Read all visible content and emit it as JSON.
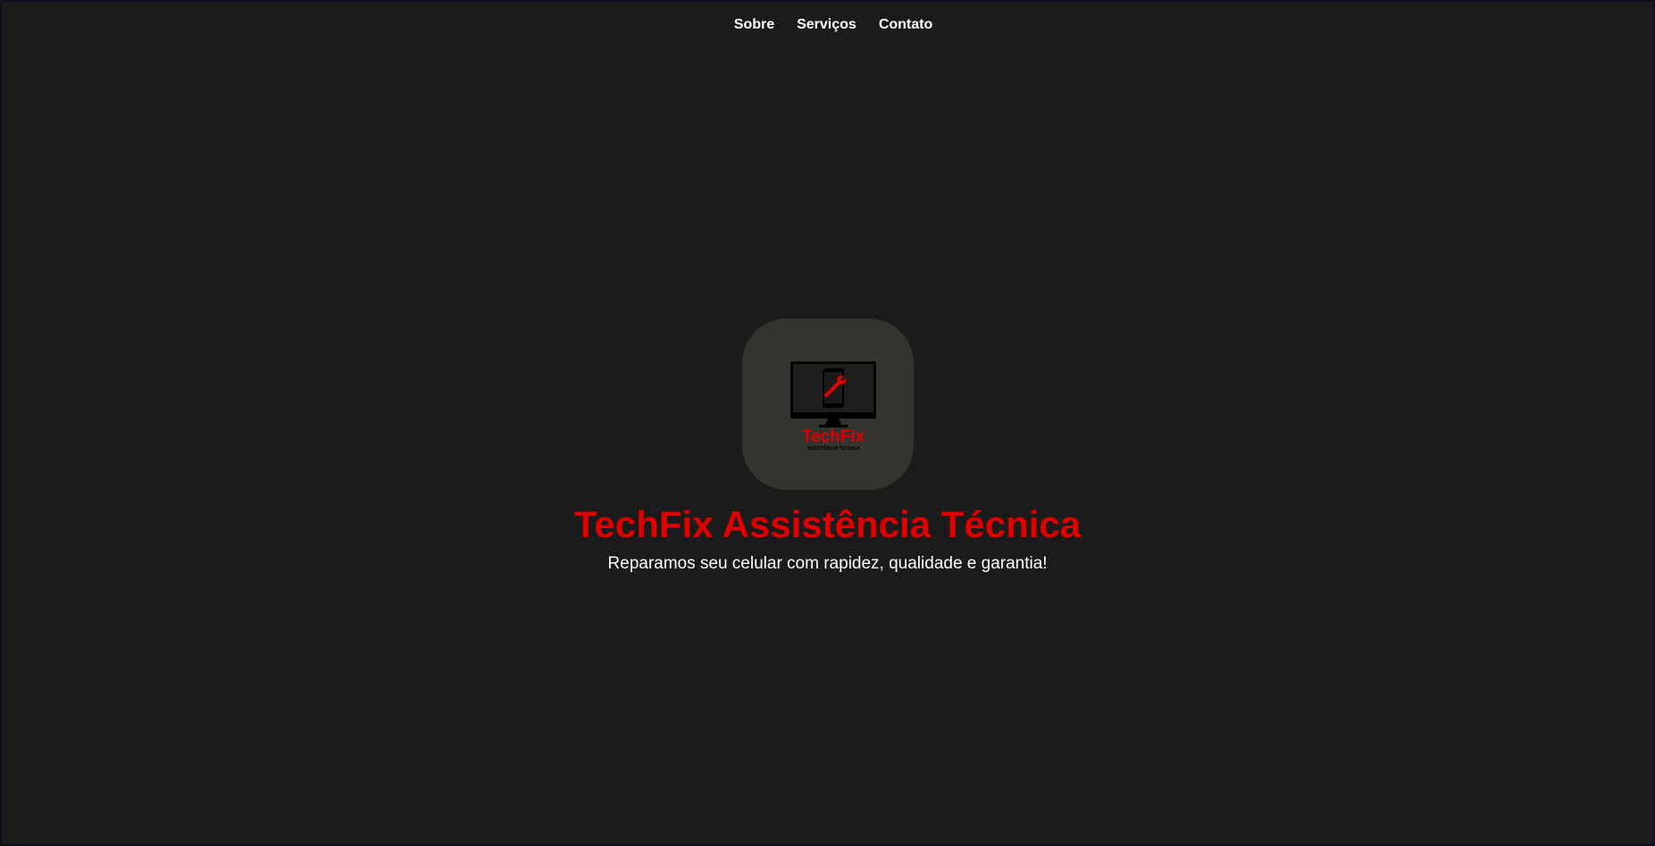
{
  "nav": {
    "items": [
      {
        "label": "Sobre"
      },
      {
        "label": "Serviços"
      },
      {
        "label": "Contato"
      }
    ]
  },
  "hero": {
    "logo": {
      "icon": "monitor-wrench-icon",
      "brand": "TechFix",
      "tagline": "ASSISTÊNCIA TÉCNICA"
    },
    "title": "TechFix Assistência Técnica",
    "subtitle": "Reparamos seu celular com rapidez, qualidade e garantia!"
  },
  "colors": {
    "background": "#1b1b1b",
    "accent": "#e00000",
    "logo_background": "#34332d",
    "text": "#ffffff"
  }
}
